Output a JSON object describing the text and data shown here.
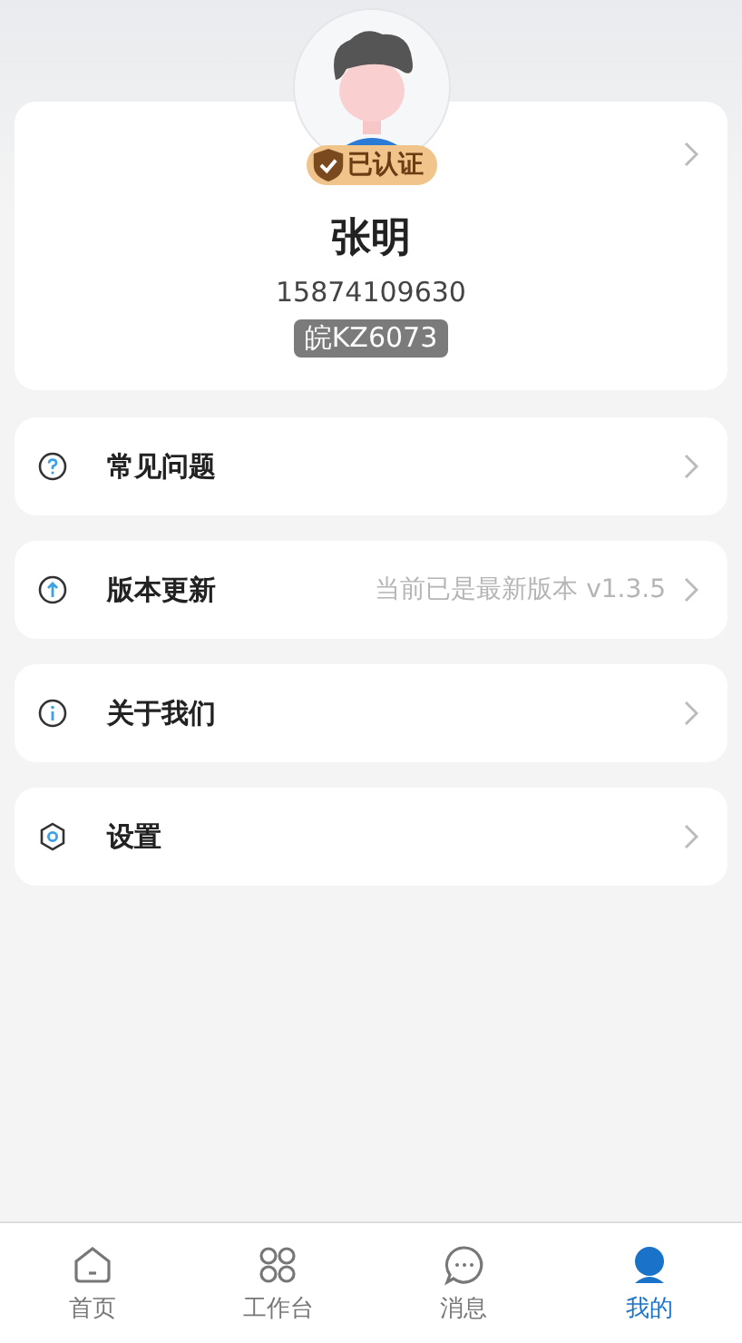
{
  "profile": {
    "badge": "已认证",
    "verified": true,
    "name": "张明",
    "phone": "15874109630",
    "plate": "皖KZ6073"
  },
  "menu": [
    {
      "kind": "help",
      "label": "常见问题"
    },
    {
      "kind": "update",
      "label": "版本更新",
      "value": "当前已是最新版本 v1.3.5"
    },
    {
      "kind": "about",
      "label": "关于我们"
    },
    {
      "kind": "settings",
      "label": "设置"
    }
  ],
  "tabs": [
    {
      "kind": "home",
      "label": "首页",
      "selected": false
    },
    {
      "kind": "grid",
      "label": "工作台",
      "selected": false
    },
    {
      "kind": "chat",
      "label": "消息",
      "selected": false
    },
    {
      "kind": "user",
      "label": "我的",
      "selected": true
    }
  ]
}
